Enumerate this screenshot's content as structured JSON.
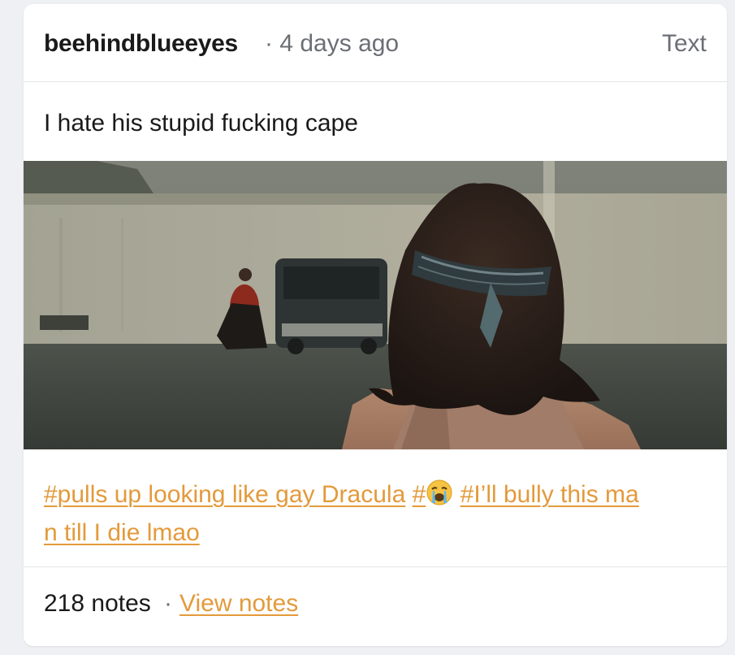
{
  "post": {
    "username": "beehindblueeyes",
    "time_sep": "·",
    "time": "4 days ago",
    "type": "Text",
    "body": "I hate his stupid fucking cape",
    "image_alt": "Film still: person with long dark hair and a bandana headband seen from behind, facing a figure in red beside a dark van in a parking lot",
    "tags": {
      "tag1": "#pulls up looking like gay Dracula",
      "tag2_prefix": "#",
      "tag2_emoji": "crying-face-emoji",
      "tag3_line1": "#I’ll bully this ma",
      "tag3_line2": "n till I die lmao"
    },
    "notes_count": "218 notes",
    "footer_sep": "·",
    "view_notes": "View notes"
  },
  "colors": {
    "accent": "#e39a3b",
    "text": "#1a1a1a",
    "muted": "#6b6f75",
    "divider": "#e3e5e8"
  }
}
